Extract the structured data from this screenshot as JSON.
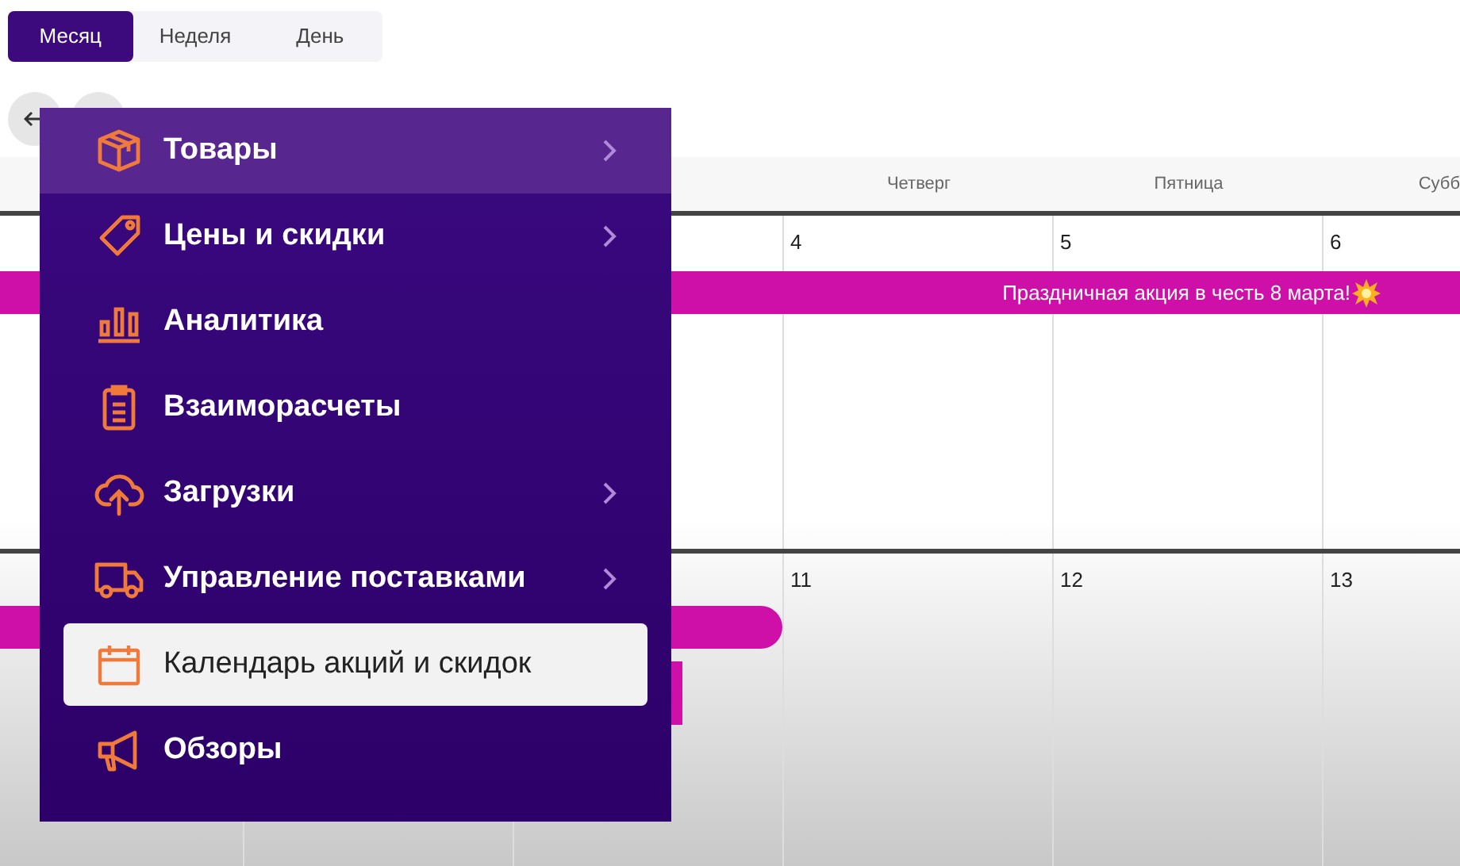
{
  "view_tabs": [
    {
      "label": "Месяц",
      "selected": true
    },
    {
      "label": "Неделя",
      "selected": false
    },
    {
      "label": "День",
      "selected": false
    }
  ],
  "calendar": {
    "weekdays": [
      "Четверг",
      "Пятница",
      "Субб"
    ],
    "weeks": [
      {
        "days": [
          "4",
          "5",
          "6"
        ],
        "event": "Праздничная акция в честь 8 марта!"
      },
      {
        "days": [
          "11",
          "12",
          "13"
        ]
      }
    ]
  },
  "menu": {
    "items": [
      {
        "label": "Товары",
        "submenu": true,
        "highlighted": true,
        "selected": false
      },
      {
        "label": "Цены и скидки",
        "submenu": true,
        "highlighted": false,
        "selected": false
      },
      {
        "label": "Аналитика",
        "submenu": false,
        "highlighted": false,
        "selected": false
      },
      {
        "label": "Взаиморасчеты",
        "submenu": false,
        "highlighted": false,
        "selected": false
      },
      {
        "label": "Загрузки",
        "submenu": true,
        "highlighted": false,
        "selected": false
      },
      {
        "label": "Управление поставками",
        "submenu": true,
        "highlighted": false,
        "selected": false
      },
      {
        "label": "Календарь акций и скидок",
        "submenu": false,
        "highlighted": false,
        "selected": true
      },
      {
        "label": "Обзоры",
        "submenu": false,
        "highlighted": false,
        "selected": false
      }
    ]
  }
}
